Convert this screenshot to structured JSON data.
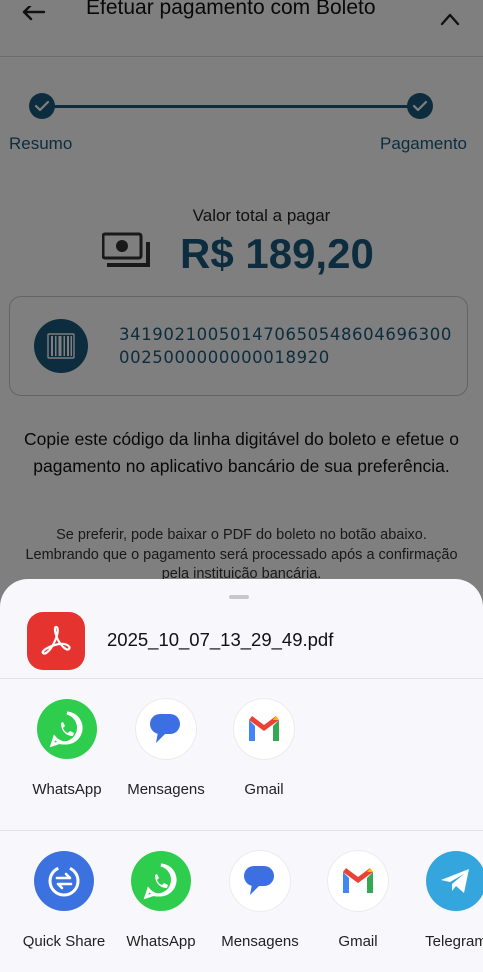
{
  "header": {
    "title": "Efetuar pagamento com Boleto"
  },
  "stepper": {
    "steps": [
      {
        "label": "Resumo"
      },
      {
        "label": "Pagamento"
      }
    ]
  },
  "payment": {
    "amount_label": "Valor total a pagar",
    "amount": "R$ 189,20",
    "barcode_line1": "341902100501470650548604696300",
    "barcode_line2": "0025000000000018920"
  },
  "instructions": "Copie este código da linha digitável do boleto e efetue o pagamento no aplicativo bancário de sua preferência.",
  "note": "Se preferir, pode baixar o PDF do boleto no botão abaixo. Lembrando que o pagamento será processado após a confirmação pela instituição bancária.",
  "share_sheet": {
    "file_name": "2025_10_07_13_29_49.pdf",
    "direct_apps": [
      {
        "label": "WhatsApp",
        "icon": "whatsapp-icon"
      },
      {
        "label": "Mensagens",
        "icon": "messages-icon"
      },
      {
        "label": "Gmail",
        "icon": "gmail-icon"
      }
    ],
    "apps": [
      {
        "label": "Quick Share",
        "icon": "quick-share-icon"
      },
      {
        "label": "WhatsApp",
        "icon": "whatsapp-icon"
      },
      {
        "label": "Mensagens",
        "icon": "messages-icon"
      },
      {
        "label": "Gmail",
        "icon": "gmail-icon"
      },
      {
        "label": "Telegram",
        "icon": "telegram-icon"
      }
    ]
  },
  "colors": {
    "primary": "#1a5a7e",
    "whatsapp": "#2ecd4e",
    "pdf": "#e5342f",
    "quick_share": "#3b72e0",
    "telegram": "#34a5dd"
  }
}
